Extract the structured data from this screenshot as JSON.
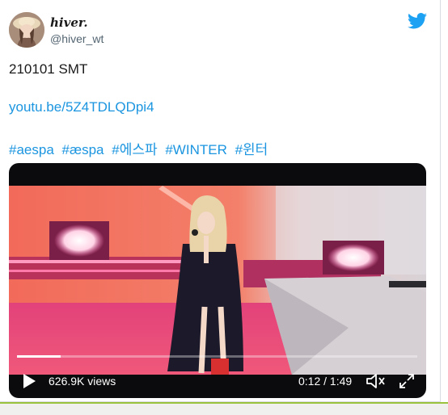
{
  "author": {
    "display_name": "hiver.",
    "handle": "@hiver_wt",
    "avatar_icon": "avatar"
  },
  "brand_icon": "twitter-bird-icon",
  "tweet": {
    "date_line": "210101 SMT",
    "link": "youtu.be/5Z4TDLQDpi4",
    "hashtags": [
      "#aespa",
      "#æspa",
      "#에스파",
      "#WINTER",
      "#윈터"
    ]
  },
  "video": {
    "views": "626.9K views",
    "time": "0:12 / 1:49",
    "progress": 0.11,
    "play_icon": "play-icon",
    "volume_icon": "volume-icon",
    "fullscreen_icon": "fullscreen-icon"
  },
  "colors": {
    "link": "#1b95e0",
    "twitter_blue": "#1da1f2",
    "stage_coral": "#f0705e",
    "accent_green": "#9ac23c"
  }
}
